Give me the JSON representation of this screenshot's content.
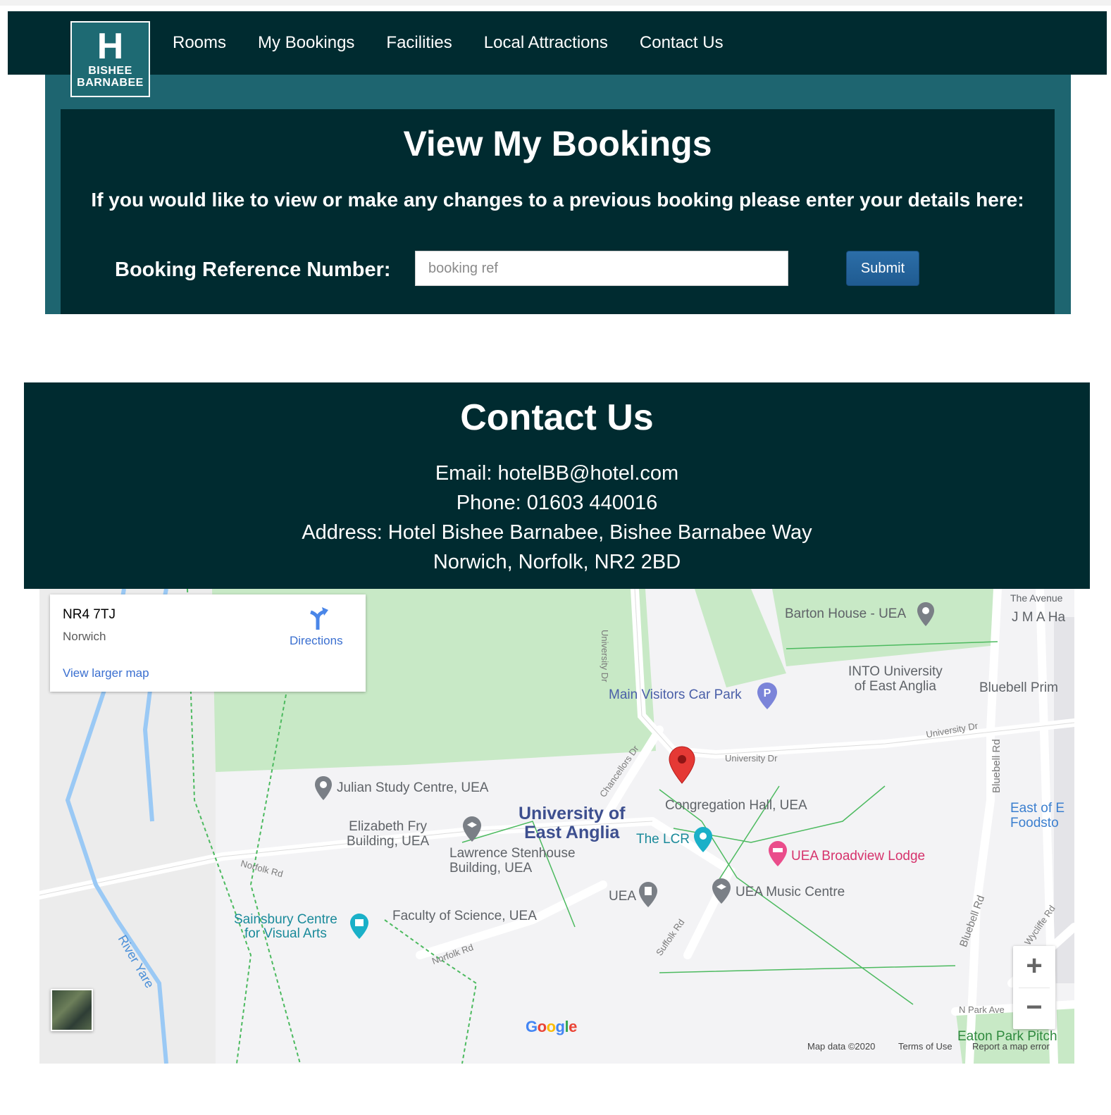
{
  "brand": {
    "logo_letter": "H",
    "logo_line1": "BISHEE",
    "logo_line2": "BARNABEE"
  },
  "nav": [
    "Rooms",
    "My Bookings",
    "Facilities",
    "Local Attractions",
    "Contact Us"
  ],
  "booking": {
    "title": "View My Bookings",
    "instructions": "If you would like to view or make any changes to a previous booking please enter your details here:",
    "ref_label": "Booking Reference Number:",
    "ref_placeholder": "booking ref",
    "ref_value": "",
    "submit_label": "Submit"
  },
  "contact": {
    "title": "Contact Us",
    "email": "Email: hotelBB@hotel.com",
    "phone": "Phone: 01603 440016",
    "address_line1": "Address: Hotel Bishee Barnabee, Bishee Barnabee Way",
    "address_line2": "Norwich, Norfolk, NR2 2BD"
  },
  "map": {
    "card": {
      "title": "NR4 7TJ",
      "subtitle": "Norwich",
      "directions": "Directions",
      "larger_map": "View larger map"
    },
    "labels": {
      "barton_house": "Barton House - UEA",
      "the_avenue": "The Avenue",
      "jma": "J M A Ha",
      "into_1": "INTO University",
      "into_2": "of East Anglia",
      "bluebell_prim": "Bluebell Prim",
      "main_visitors": "Main Visitors Car Park",
      "university_dr": "University Dr",
      "university_dr_2": "University Dr",
      "university_dr_3": "University Dr",
      "chancellors_dr": "Chancellors Dr",
      "bluebell_rd": "Bluebell Rd",
      "bluebell_rd_2": "Bluebell Rd",
      "julian": "Julian Study Centre, UEA",
      "uea_1": "University of",
      "uea_2": "East Anglia",
      "congregation": "Congregation Hall, UEA",
      "east_of_1": "East of E",
      "east_of_2": "Foodsto",
      "elizabeth_1": "Elizabeth Fry",
      "elizabeth_2": "Building, UEA",
      "lawrence_1": "Lawrence Stenhouse",
      "lawrence_2": "Building, UEA",
      "the_lcr": "The LCR",
      "broadview": "UEA Broadview Lodge",
      "norfolk_rd": "Norfolk Rd",
      "norfolk_rd_2": "Norfolk Rd",
      "sainsbury_1": "Sainsbury Centre",
      "sainsbury_2": "for Visual Arts",
      "faculty": "Faculty of Science, UEA",
      "uea_short": "UEA",
      "music_centre": "UEA Music Centre",
      "suffolk_rd": "Suffolk Rd",
      "wycliffe_rd": "Wycliffe Rd",
      "river_yare": "River Yare",
      "n_park_ave": "N Park Ave",
      "eaton_park": "Eaton Park Pitch"
    },
    "google_logo": "Google",
    "map_data": "Map data ©2020",
    "terms": "Terms of Use",
    "report": "Report a map error",
    "zoom_in": "+",
    "zoom_out": "−",
    "colors": {
      "park": "#c8e9c6",
      "water": "#9ac9f5",
      "footpath": "#4cba5f",
      "marker": "#e53935"
    }
  }
}
